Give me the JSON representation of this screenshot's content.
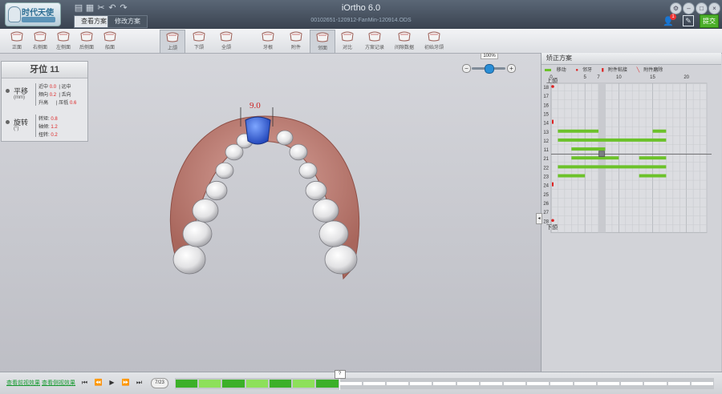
{
  "titlebar": {
    "app_title": "iOrtho 6.0",
    "file_name": "00102651-120912-FanMin-120914.ODS",
    "tabs": [
      {
        "label": "查看方案",
        "active": true
      },
      {
        "label": "修改方案",
        "active": false
      }
    ],
    "notification_count": "1",
    "submit_label": "提交"
  },
  "toolbar": {
    "tools": [
      {
        "label": "正面",
        "icon": "front-view-icon"
      },
      {
        "label": "右侧面",
        "icon": "right-side-view-icon"
      },
      {
        "label": "左侧面",
        "icon": "left-side-view-icon"
      },
      {
        "label": "后侧面",
        "icon": "back-view-icon"
      },
      {
        "label": "船面",
        "icon": "occlusal-view-icon"
      },
      {
        "label": "上颌",
        "icon": "upper-jaw-icon",
        "active": true
      },
      {
        "label": "下颌",
        "icon": "lower-jaw-icon"
      },
      {
        "label": "全颌",
        "icon": "full-jaw-icon"
      },
      {
        "label": "牙根",
        "icon": "tooth-root-icon"
      },
      {
        "label": "附件",
        "icon": "attachment-icon"
      },
      {
        "label": "邻面",
        "icon": "interproximal-icon",
        "active": true
      },
      {
        "label": "对比",
        "icon": "compare-icon"
      },
      {
        "label": "方案记录",
        "icon": "plan-record-icon"
      },
      {
        "label": "间隙数据",
        "icon": "gap-data-icon"
      },
      {
        "label": "初始牙颌",
        "icon": "initial-jaw-icon"
      }
    ]
  },
  "tooth_panel": {
    "title": "牙位  11",
    "translation": {
      "title": "平移",
      "unit": "(mm)",
      "rows": [
        {
          "label": "近中",
          "value": "0.0",
          "dir": "远中"
        },
        {
          "label": "颊向",
          "value": "0.2",
          "dir": "舌向"
        },
        {
          "label": "升高",
          "dir": "压低",
          "value": "0.6"
        }
      ]
    },
    "rotation": {
      "title": "旋转",
      "unit": "(°)",
      "rows": [
        {
          "label": "转矩:",
          "value": "0.8"
        },
        {
          "label": "轴倾:",
          "value": "1.2"
        },
        {
          "label": "扭转:",
          "value": "0.2"
        }
      ]
    }
  },
  "viewport": {
    "selected_tooth_label": "9.0",
    "zoom_label": "100%",
    "zoom_level": 0.5,
    "highlight_color": "#2f5fd8"
  },
  "plan_panel": {
    "title": "矫正方案",
    "legend": [
      "移动",
      "邻牙",
      "附件粘接",
      "附件磨除"
    ],
    "steps_axis": [
      "0",
      "5",
      "7",
      "10",
      "15",
      "20"
    ],
    "upper_label": "上颌",
    "lower_label": "下颌",
    "teeth_rows": [
      "18",
      "17",
      "16",
      "15",
      "14",
      "13",
      "12",
      "11",
      "21",
      "22",
      "23",
      "24",
      "25",
      "26",
      "27",
      "28"
    ],
    "movement_color": "#6cc22a",
    "movement_bars": [
      {
        "tooth": "13",
        "from": 1,
        "to": 7
      },
      {
        "tooth": "13",
        "from": 15,
        "to": 17
      },
      {
        "tooth": "12",
        "from": 1,
        "to": 17
      },
      {
        "tooth": "11",
        "from": 3,
        "to": 8
      },
      {
        "tooth": "21",
        "from": 3,
        "to": 10
      },
      {
        "tooth": "21",
        "from": 13,
        "to": 17
      },
      {
        "tooth": "22",
        "from": 1,
        "to": 17
      },
      {
        "tooth": "23",
        "from": 1,
        "to": 5
      },
      {
        "tooth": "23",
        "from": 13,
        "to": 17
      }
    ],
    "markers": [
      {
        "tooth": "18",
        "type": "dot"
      },
      {
        "tooth": "14",
        "type": "tick"
      },
      {
        "tooth": "24",
        "type": "tick"
      },
      {
        "tooth": "28",
        "type": "dot"
      }
    ],
    "current_step": 7
  },
  "bottom": {
    "link1": "查看前视效果",
    "link2": "查看侧视效果",
    "step_count": "7/23",
    "marker": "?",
    "total_steps": 23,
    "current_step": 7
  }
}
